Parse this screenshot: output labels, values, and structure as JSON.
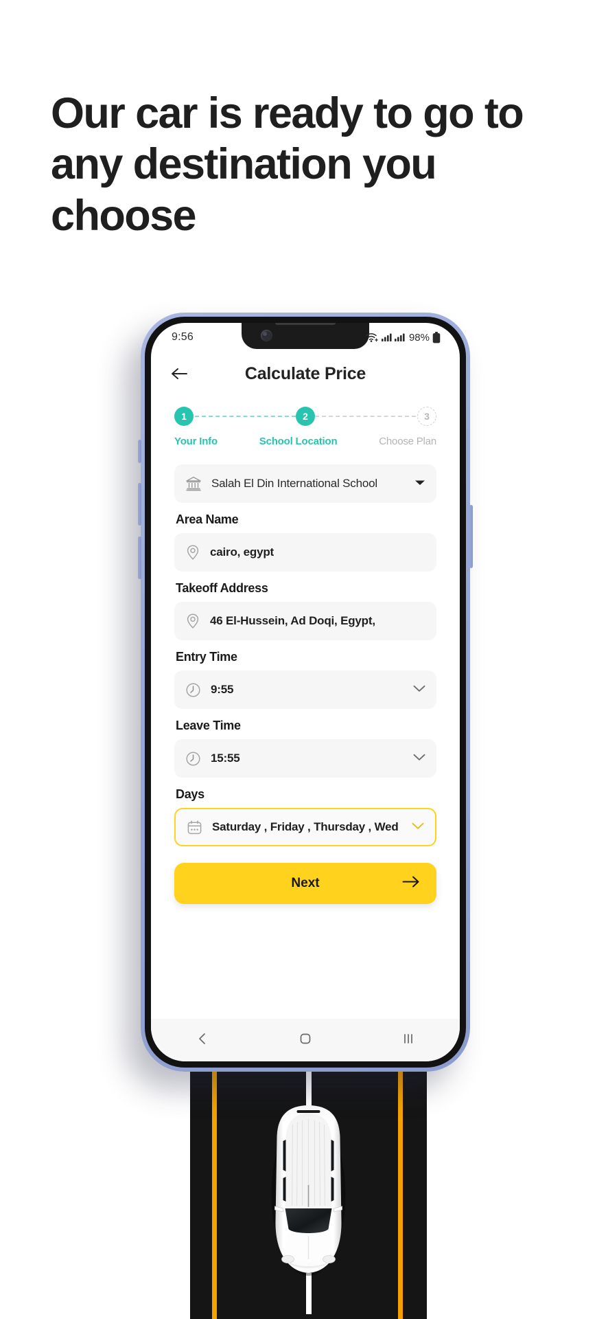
{
  "headline": "Our car is ready to go to any destination you choose",
  "phone": {
    "status_bar": {
      "time": "9:56",
      "wifi_icon": "wifi-plus-icon",
      "signal_icon_1": "signal-bars-icon",
      "signal_icon_2": "signal-bars-icon",
      "battery_percent": "98%",
      "battery_icon": "battery-full-icon"
    },
    "header": {
      "back_icon": "back-arrow-icon",
      "title": "Calculate Price"
    },
    "stepper": {
      "steps": [
        {
          "number": "1",
          "label": "Your Info",
          "state": "done"
        },
        {
          "number": "2",
          "label": "School Location",
          "state": "active"
        },
        {
          "number": "3",
          "label": "Choose Plan",
          "state": "pending"
        }
      ],
      "active_color": "#29C4AF",
      "pending_color": "#b4b4b4"
    },
    "form": {
      "school": {
        "icon": "bank-school-icon",
        "value": "Salah El Din International School",
        "chevron_icon": "caret-down-icon"
      },
      "fields": [
        {
          "label": "Area Name",
          "icon": "location-pin-icon",
          "value": "cairo, egypt",
          "chevron_icon": "",
          "highlight": false
        },
        {
          "label": "Takeoff Address",
          "icon": "location-pin-icon",
          "value": "46 El-Hussein, Ad Doqi, Egypt,",
          "chevron_icon": "",
          "highlight": false
        },
        {
          "label": "Entry Time",
          "icon": "clock-icon",
          "value": "9:55",
          "chevron_icon": "chevron-down-icon",
          "highlight": false
        },
        {
          "label": "Leave Time",
          "icon": "clock-icon",
          "value": "15:55",
          "chevron_icon": "chevron-down-icon",
          "highlight": false
        },
        {
          "label": "Days",
          "icon": "calendar-icon",
          "value": "Saturday , Friday , Thursday , Wed",
          "chevron_icon": "chevron-down-icon",
          "highlight": true
        }
      ],
      "next_button": {
        "label": "Next",
        "arrow_icon": "arrow-right-icon",
        "color": "#FFD21E"
      }
    },
    "nav_bar": {
      "back_icon": "nav-back-icon",
      "home_icon": "nav-home-icon",
      "recents_icon": "nav-recents-icon"
    }
  },
  "scene": {
    "road_color": "#151515",
    "lane_marking_color": "#F5A200",
    "center_dash_color": "#ffffff",
    "car_icon": "white-car-top-view"
  },
  "colors": {
    "accent_teal": "#29C4AF",
    "accent_yellow": "#FFD21E",
    "text_dark": "#1f1f1f",
    "field_bg": "#F6F6F6"
  }
}
